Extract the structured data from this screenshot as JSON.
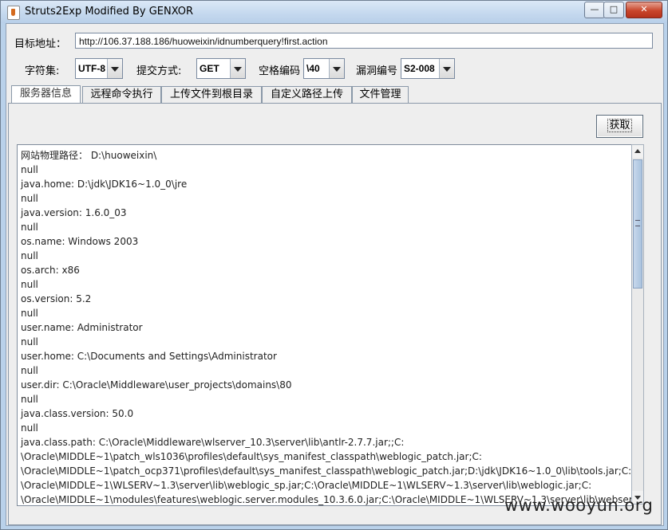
{
  "window": {
    "title": "Struts2Exp Modified By GENXOR",
    "controls": {
      "minimize": "—",
      "maximize": "□",
      "close": "✕"
    }
  },
  "form": {
    "target_label": "目标地址：",
    "target_value": "http://106.37.188.186/huoweixin/idnumberquery!first.action",
    "charset_label": "字符集:",
    "charset_value": "UTF-8",
    "method_label": "提交方式:",
    "method_value": "GET",
    "space_label": "空格编码",
    "space_value": "\\40",
    "vuln_label": "漏洞编号",
    "vuln_value": "S2-008"
  },
  "tabs": [
    {
      "label": "服务器信息"
    },
    {
      "label": "远程命令执行"
    },
    {
      "label": "上传文件到根目录"
    },
    {
      "label": "自定义路径上传"
    },
    {
      "label": "文件管理"
    }
  ],
  "panel": {
    "fetch_button": "获取",
    "output_lines": [
      "网站物理路径：  D:\\huoweixin\\",
      "null",
      "java.home: D:\\jdk\\JDK16~1.0_0\\jre",
      "null",
      "java.version: 1.6.0_03",
      "null",
      "os.name: Windows 2003",
      "null",
      "os.arch: x86",
      "null",
      "os.version: 5.2",
      "null",
      "user.name: Administrator",
      "null",
      "user.home: C:\\Documents and Settings\\Administrator",
      "null",
      "user.dir: C:\\Oracle\\Middleware\\user_projects\\domains\\80",
      "null",
      "java.class.version: 50.0",
      "null",
      "java.class.path: C:\\Oracle\\Middleware\\wlserver_10.3\\server\\lib\\antlr-2.7.7.jar;;C:",
      "\\Oracle\\MIDDLE~1\\patch_wls1036\\profiles\\default\\sys_manifest_classpath\\weblogic_patch.jar;C:",
      "\\Oracle\\MIDDLE~1\\patch_ocp371\\profiles\\default\\sys_manifest_classpath\\weblogic_patch.jar;D:\\jdk\\JDK16~1.0_0\\lib\\tools.jar;C:",
      "\\Oracle\\MIDDLE~1\\WLSERV~1.3\\server\\lib\\weblogic_sp.jar;C:\\Oracle\\MIDDLE~1\\WLSERV~1.3\\server\\lib\\weblogic.jar;C:",
      "\\Oracle\\MIDDLE~1\\modules\\features\\weblogic.server.modules_10.3.6.0.jar;C:\\Oracle\\MIDDLE~1\\WLSERV~1.3\\server\\lib\\webservices.jar;C:"
    ]
  },
  "watermark": "www.wooyun.org"
}
